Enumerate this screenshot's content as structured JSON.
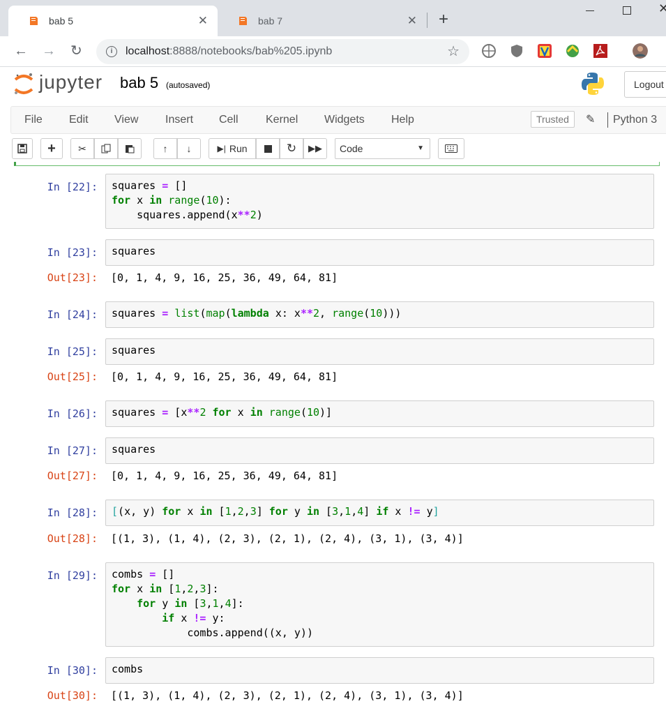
{
  "browser": {
    "tabs": [
      {
        "title": "bab 5",
        "active": true
      },
      {
        "title": "bab 7",
        "active": false
      }
    ],
    "url_host": "localhost",
    "url_path": ":8888/notebooks/bab%205.ipynb"
  },
  "jupyter": {
    "logo_text": "jupyter",
    "notebook_name": "bab 5",
    "save_status": "(autosaved)",
    "logout_label": "Logout",
    "menu": [
      "File",
      "Edit",
      "View",
      "Insert",
      "Cell",
      "Kernel",
      "Widgets",
      "Help"
    ],
    "trusted_label": "Trusted",
    "kernel_name": "Python 3",
    "run_label": "Run",
    "cell_type": "Code",
    "accent_color": "#f37726"
  },
  "cells": {
    "c22": {
      "in": "In [22]:"
    },
    "c23": {
      "in": "In [23]:",
      "out": "Out[23]:",
      "result": "[0, 1, 4, 9, 16, 25, 36, 49, 64, 81]"
    },
    "c24": {
      "in": "In [24]:"
    },
    "c25": {
      "in": "In [25]:",
      "out": "Out[25]:",
      "result": "[0, 1, 4, 9, 16, 25, 36, 49, 64, 81]"
    },
    "c26": {
      "in": "In [26]:"
    },
    "c27": {
      "in": "In [27]:",
      "out": "Out[27]:",
      "result": "[0, 1, 4, 9, 16, 25, 36, 49, 64, 81]"
    },
    "c28": {
      "in": "In [28]:",
      "out": "Out[28]:",
      "result": "[(1, 3), (1, 4), (2, 3), (2, 1), (2, 4), (3, 1), (3, 4)]"
    },
    "c29": {
      "in": "In [29]:"
    },
    "c30": {
      "in": "In [30]:",
      "out": "Out[30]:",
      "result": "[(1, 3), (1, 4), (2, 3), (2, 1), (2, 4), (3, 1), (3, 4)]"
    }
  },
  "code": {
    "t_squares": "squares",
    "t_combs": "combs",
    "t_eq": "=",
    "t_list_empty": "[]",
    "t_for": "for",
    "t_x": "x",
    "t_y": "y",
    "t_in": "in",
    "t_if": "if",
    "t_range": "range",
    "t_ten": "10",
    "t_two": "2",
    "t_pow": "**",
    "t_neq": "!=",
    "t_lambda": "lambda",
    "t_list": "list",
    "t_map": "map",
    "t_append_sq": "squares.append(",
    "t_append_cb": "combs.append((x, y))",
    "t_one": "1",
    "t_three": "3",
    "t_four": "4"
  }
}
